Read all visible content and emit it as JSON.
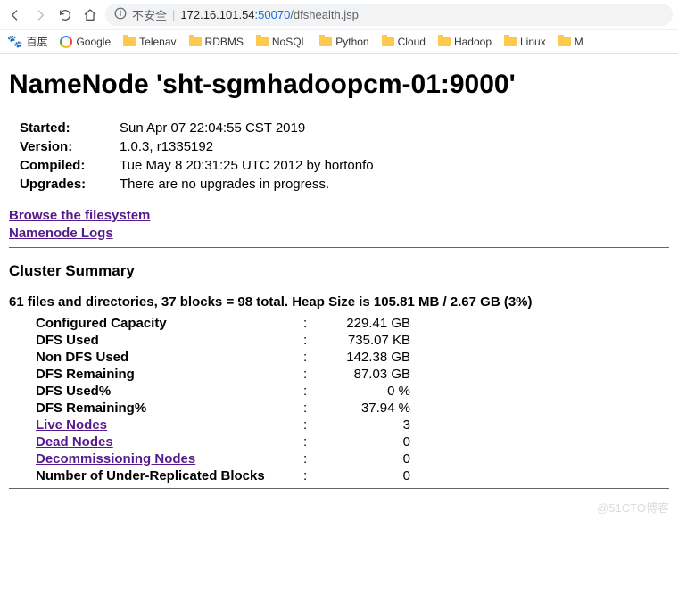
{
  "browser": {
    "insecure_label": "不安全",
    "url_host": "172.16.101.54",
    "url_port": ":50070",
    "url_path": "/dfshealth.jsp"
  },
  "bookmarks": [
    {
      "label": "百度",
      "icon": "baidu"
    },
    {
      "label": "Google",
      "icon": "google"
    },
    {
      "label": "Telenav",
      "icon": "folder"
    },
    {
      "label": "RDBMS",
      "icon": "folder"
    },
    {
      "label": "NoSQL",
      "icon": "folder"
    },
    {
      "label": "Python",
      "icon": "folder"
    },
    {
      "label": "Cloud",
      "icon": "folder"
    },
    {
      "label": "Hadoop",
      "icon": "folder"
    },
    {
      "label": "Linux",
      "icon": "folder"
    },
    {
      "label": "M",
      "icon": "folder"
    }
  ],
  "page": {
    "title": "NameNode 'sht-sgmhadoopcm-01:9000'",
    "info": {
      "started_label": "Started:",
      "started_value": "Sun Apr 07 22:04:55 CST 2019",
      "version_label": "Version:",
      "version_value": "1.0.3, r1335192",
      "compiled_label": "Compiled:",
      "compiled_value": "Tue May  8 20:31:25 UTC 2012 by hortonfo",
      "upgrades_label": "Upgrades:",
      "upgrades_value": "There are no upgrades in progress."
    },
    "links": {
      "browse": "Browse the filesystem",
      "logs": "Namenode Logs"
    },
    "cluster_heading": "Cluster Summary",
    "summary_line": "61 files and directories, 37 blocks = 98 total. Heap Size is 105.81 MB / 2.67 GB (3%)",
    "metrics": [
      {
        "label": "Configured Capacity",
        "value": "229.41 GB",
        "link": false
      },
      {
        "label": "DFS Used",
        "value": "735.07 KB",
        "link": false
      },
      {
        "label": "Non DFS Used",
        "value": "142.38 GB",
        "link": false
      },
      {
        "label": "DFS Remaining",
        "value": "87.03 GB",
        "link": false
      },
      {
        "label": "DFS Used%",
        "value": "0 %",
        "link": false
      },
      {
        "label": "DFS Remaining%",
        "value": "37.94 %",
        "link": false
      },
      {
        "label": "Live Nodes",
        "value": "3",
        "link": true
      },
      {
        "label": "Dead Nodes",
        "value": "0",
        "link": true
      },
      {
        "label": "Decommissioning Nodes",
        "value": "0",
        "link": true
      },
      {
        "label": "Number of Under-Replicated Blocks",
        "value": "0",
        "link": false
      }
    ]
  },
  "watermark": "@51CTO博客"
}
